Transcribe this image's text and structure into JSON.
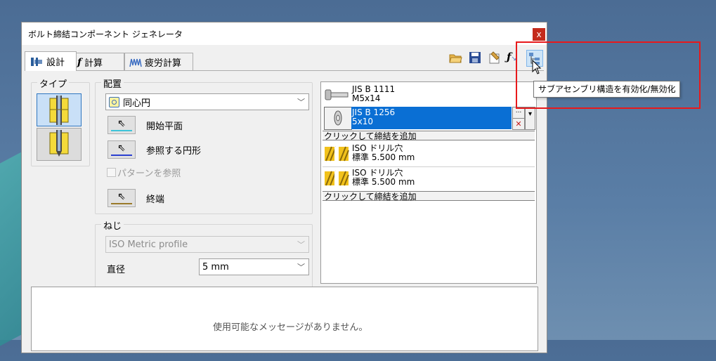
{
  "window": {
    "title": "ボルト締結コンポーネント ジェネレータ",
    "close_glyph": "x"
  },
  "tabs": [
    {
      "label": "設計",
      "icon": "bolt-design-icon"
    },
    {
      "label": "計算",
      "icon": "fx-calc-icon"
    },
    {
      "label": "疲労計算",
      "icon": "fatigue-icon"
    }
  ],
  "toolbar": {
    "icons": [
      "open-folder-icon",
      "save-icon",
      "options-icon",
      "fx-icon",
      "subassembly-toggle-icon"
    ]
  },
  "type_group": {
    "title": "タイプ"
  },
  "placement": {
    "title": "配置",
    "combo_value": "同心円",
    "start_plane": "開始平面",
    "reference_circle": "参照する円形",
    "pattern_label": "パターンを参照",
    "termination": "終端"
  },
  "thread": {
    "title": "ねじ",
    "profile": "ISO Metric profile",
    "diameter_label": "直径",
    "diameter_value": "5 mm"
  },
  "components": {
    "bolt": {
      "line1": "JIS B 1111",
      "line2": "M5x14"
    },
    "washer": {
      "line1": "JIS B 1256",
      "line2": "5x10"
    },
    "add_fastener_1": "クリックして締結を追加",
    "hole1": {
      "line1": "ISO ドリル穴",
      "line2": "標準 5.500 mm"
    },
    "hole2": {
      "line1": "ISO ドリル穴",
      "line2": "標準 5.500 mm"
    },
    "add_fastener_2": "クリックして締結を追加",
    "more_glyph": "...",
    "delete_glyph": "✕",
    "dropdown_glyph": "▾"
  },
  "messages": {
    "empty": "使用可能なメッセージがありません。"
  },
  "tooltip": {
    "text": "サブアセンブリ構造を有効化/無効化"
  },
  "colors": {
    "selection": "#0a6fd4",
    "annotation_red": "#e8191b"
  }
}
